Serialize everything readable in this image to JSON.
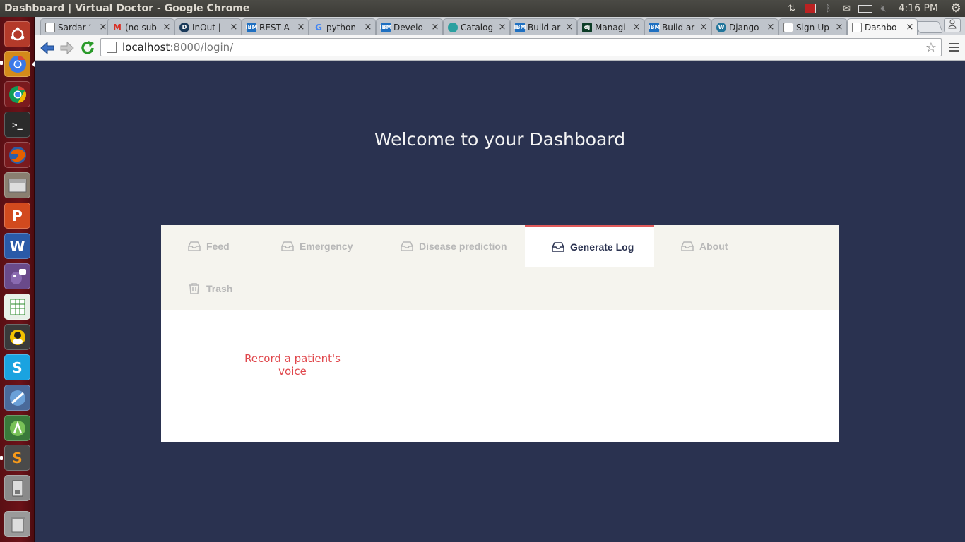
{
  "os": {
    "window_title": "Dashboard | Virtual Doctor - Google Chrome",
    "clock": "4:16 PM",
    "tray_icons": [
      "transfer-icon",
      "record-icon",
      "bluetooth-icon",
      "mail-icon",
      "battery-icon",
      "volume-muted-icon",
      "gear-icon"
    ],
    "launcher_apps": [
      "ubuntu-dash",
      "chromium",
      "chrome",
      "terminal",
      "firefox",
      "files",
      "wps-presentation",
      "wps-writer",
      "pidgin",
      "spreadsheet",
      "gnome-games",
      "skype",
      "unknown-app",
      "android-studio",
      "sublime-text",
      "usb-drive",
      "trash"
    ]
  },
  "browser": {
    "tabs": [
      {
        "label": "Sardar ’",
        "favicon": "page-icon"
      },
      {
        "label": "(no sub",
        "favicon": "gmail-icon"
      },
      {
        "label": "InOut |",
        "favicon": "inout-icon"
      },
      {
        "label": "REST A",
        "favicon": "ibm-icon"
      },
      {
        "label": "python",
        "favicon": "google-icon"
      },
      {
        "label": "Develo",
        "favicon": "ibm-icon"
      },
      {
        "label": "Catalog",
        "favicon": "catalog-icon"
      },
      {
        "label": "Build ar",
        "favicon": "ibm-icon"
      },
      {
        "label": "Managi",
        "favicon": "django-icon"
      },
      {
        "label": "Build ar",
        "favicon": "ibm-icon"
      },
      {
        "label": "Django",
        "favicon": "wordpress-icon"
      },
      {
        "label": "Sign-Up",
        "favicon": "page-icon"
      },
      {
        "label": "Dashbo",
        "favicon": "page-icon"
      }
    ],
    "active_tab": 12,
    "url_host": "localhost",
    "url_path": ":8000/login/"
  },
  "page": {
    "title": "Welcome to your Dashboard",
    "nav_tabs": [
      {
        "label": "Feed",
        "icon": "inbox-icon"
      },
      {
        "label": "Emergency",
        "icon": "inbox-icon"
      },
      {
        "label": "Disease prediction",
        "icon": "inbox-icon"
      },
      {
        "label": "Generate Log",
        "icon": "inbox-icon"
      },
      {
        "label": "About",
        "icon": "inbox-icon"
      },
      {
        "label": "Trash",
        "icon": "trash-icon"
      }
    ],
    "active_nav_tab": 3,
    "record_link_line1": "Record a patient's",
    "record_link_line2": "voice"
  },
  "colors": {
    "page_bg": "#2a3250",
    "tabs_bar_bg": "#f5f4ee",
    "accent": "#e05a5a",
    "record_text": "#e0474c",
    "inactive_tab_text": "#b8b8b8"
  }
}
